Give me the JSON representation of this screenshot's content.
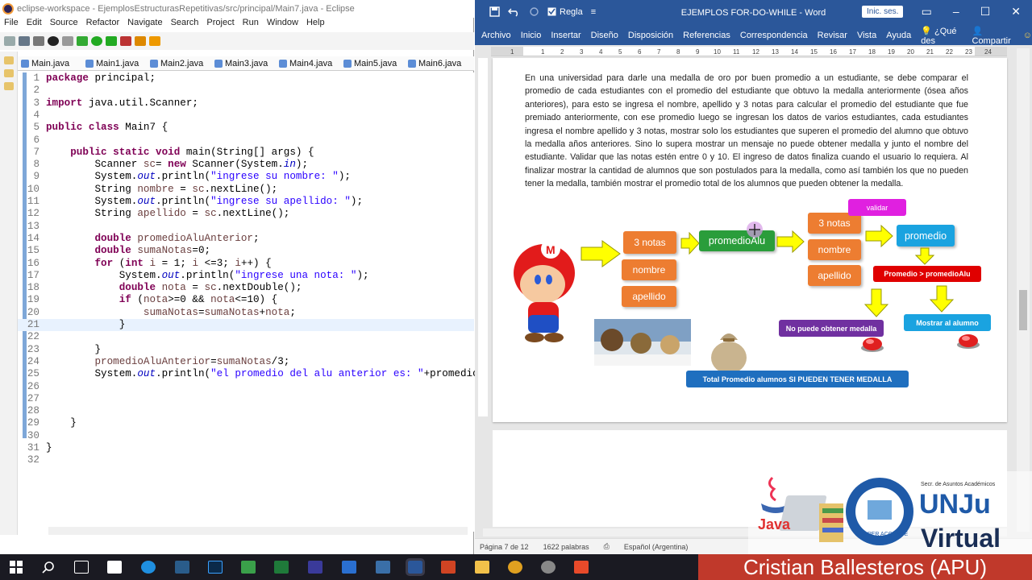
{
  "eclipse": {
    "title": "eclipse-workspace - EjemplosEstructurasRepetitivas/src/principal/Main7.java - Eclipse",
    "menu": [
      "File",
      "Edit",
      "Source",
      "Refactor",
      "Navigate",
      "Search",
      "Project",
      "Run",
      "Window",
      "Help"
    ],
    "tabs": [
      "Main.java",
      "Main1.java",
      "Main2.java",
      "Main3.java",
      "Main4.java",
      "Main5.java",
      "Main6.java"
    ],
    "line_numbers": [
      "1",
      "2",
      "3",
      "4",
      "5",
      "6",
      "7",
      "8",
      "9",
      "10",
      "11",
      "12",
      "13",
      "14",
      "15",
      "16",
      "17",
      "18",
      "19",
      "20",
      "21",
      "22",
      "23",
      "24",
      "25",
      "26",
      "27",
      "28",
      "29",
      "30",
      "31",
      "32"
    ]
  },
  "word": {
    "doc_title": "EJEMPLOS FOR-DO-WHILE - Word",
    "ruler_label": "Regla",
    "session_button": "Inic. ses.",
    "ribbon": [
      "Archivo",
      "Inicio",
      "Insertar",
      "Diseño",
      "Disposición",
      "Referencias",
      "Correspondencia",
      "Revisar",
      "Vista",
      "Ayuda",
      "¿Qué des",
      "Compartir"
    ],
    "paragraph": "En una universidad para darle una medalla de oro por buen promedio a un estudiante, se debe comparar el promedio de cada estudiantes con el promedio del estudiante que obtuvo la medalla anteriormente (ósea años anteriores), para esto se ingresa el nombre, apellido y 3 notas para calcular el promedio del estudiante que fue premiado anteriormente, con ese promedio luego se ingresan los datos de varios estudiantes, cada estudiantes ingresa el nombre apellido y 3 notas, mostrar solo los estudiantes que superen el promedio del alumno que obtuvo la medalla años anteriores. Sino lo supera mostrar un mensaje no puede obtener medalla y junto el nombre del estudiante. Validar que las notas estén entre 0 y 10. El ingreso de datos finaliza cuando el usuario lo requiera. Al finalizar mostrar la cantidad de alumnos que son postulados para la medalla, como así también los que no pueden tener la medalla, también mostrar el promedio total de los alumnos que pueden obtener la medalla.",
    "diagram": {
      "b1": "3 notas",
      "b2": "nombre",
      "b3": "apellido",
      "promedioalu": "promedioAlu",
      "c1": "3 notas",
      "c2": "nombre",
      "c3": "apellido",
      "validar": "validar",
      "promedio": "promedio",
      "cond": "Promedio > promedioAlu",
      "no": "No puede obtener medalla",
      "si": "Mostrar al alumno",
      "total": "Total Promedio alumnos SI PUEDEN TENER MEDALLA"
    },
    "status": {
      "page": "Página 7 de 12",
      "words": "1622 palabras",
      "lang": "Español (Argentina)"
    }
  },
  "overlay": {
    "java": "Java",
    "secr": "Secr. de Asuntos Académicos",
    "unju": "UNJu",
    "virtual": "Virtual"
  },
  "brand": "Cristian Ballesteros (APU)",
  "colors": {
    "word_blue": "#2b579a",
    "orange": "#ed7d31",
    "green": "#2a9d3b",
    "blue": "#1aa3e0",
    "red": "#e00000",
    "purple": "#7030a0",
    "magenta": "#e020e0",
    "brand_red": "#c0392b"
  }
}
